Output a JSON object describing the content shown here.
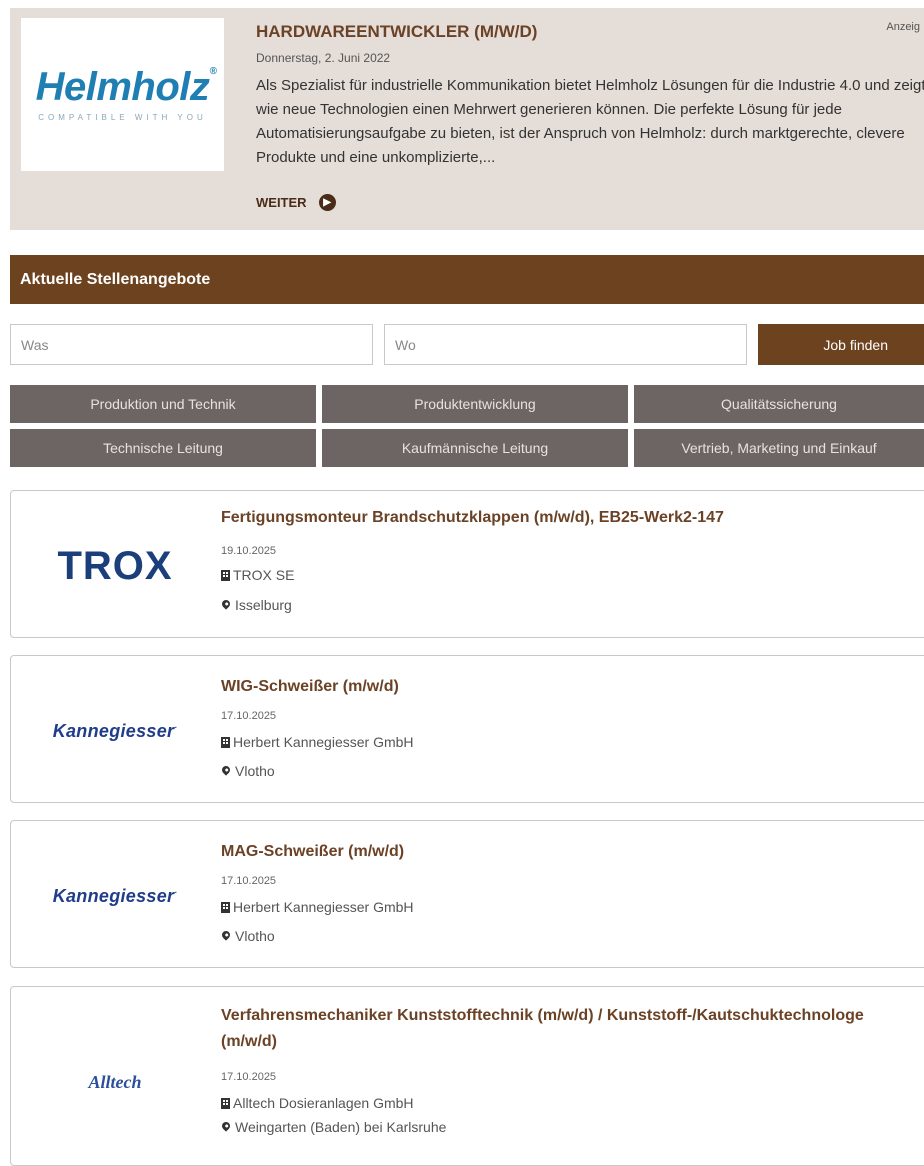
{
  "ad": {
    "logo_brand": "Helmholz",
    "logo_reg": "®",
    "logo_tagline": "COMPATIBLE WITH YOU",
    "title": "HARDWAREENTWICKLER (M/W/D)",
    "date": "Donnerstag, 2. Juni 2022",
    "badge": "Anzeig",
    "text": "Als Spezialist für industrielle Kommunikation bietet Helmholz Lösungen für die Industrie 4.0 und zeigt wie neue Technologien einen Mehrwert generieren können. Die perfekte Lösung für jede Automatisierungsaufgabe zu bieten, ist der Anspruch von Helmholz: durch marktgerechte, clevere Produkte und eine unkomplizierte,...",
    "more_label": "WEITER"
  },
  "section": {
    "title": "Aktuelle Stellenangebote"
  },
  "search": {
    "what_placeholder": "Was",
    "where_placeholder": "Wo",
    "button_label": "Job finden"
  },
  "categories": [
    "Produktion und Technik",
    "Produktentwicklung",
    "Qualitätssicherung",
    "Technische Leitung",
    "Kaufmännische Leitung",
    "Vertrieb, Marketing und Einkauf"
  ],
  "jobs": [
    {
      "logo": "TROX",
      "title": "Fertigungsmonteur Brandschutzklappen (m/w/d), EB25-Werk2-147",
      "date": "19.10.2025",
      "company": "TROX SE",
      "location": "Isselburg"
    },
    {
      "logo": "Kannegiesser",
      "title": "WIG-Schweißer (m/w/d)",
      "date": "17.10.2025",
      "company": "Herbert Kannegiesser GmbH",
      "location": "Vlotho"
    },
    {
      "logo": "Kannegiesser",
      "title": "MAG-Schweißer (m/w/d)",
      "date": "17.10.2025",
      "company": "Herbert Kannegiesser GmbH",
      "location": "Vlotho"
    },
    {
      "logo": "Alltech",
      "title": "Verfahrensmechaniker Kunststofftechnik (m/w/d) / Kunststoff-/Kautschuktechnologe (m/w/d)",
      "date": "17.10.2025",
      "company": "Alltech Dosieranlagen GmbH",
      "location": "Weingarten (Baden) bei Karlsruhe"
    }
  ]
}
